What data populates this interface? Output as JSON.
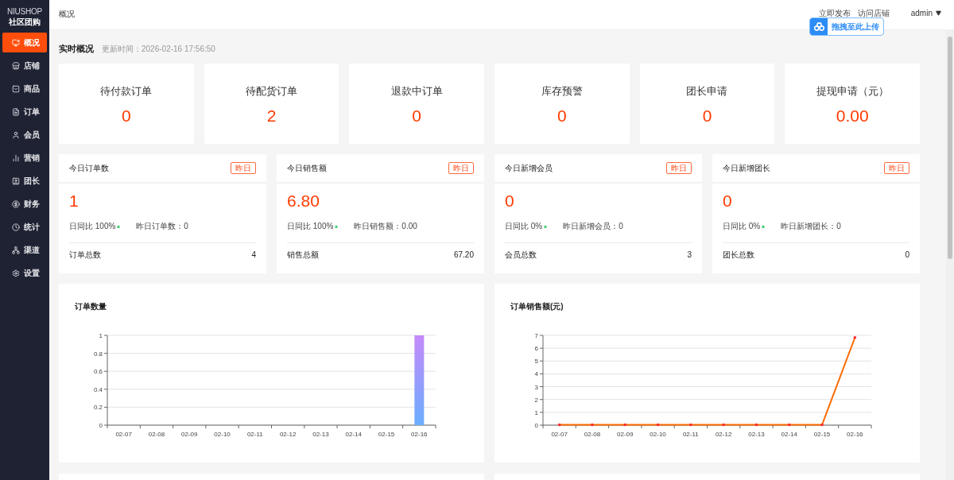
{
  "sidebar": {
    "logo": "NIUSHOP",
    "subtitle": "社区团购",
    "items": [
      {
        "label": "概况",
        "selected": true
      },
      {
        "label": "店铺",
        "selected": false
      },
      {
        "label": "商品",
        "selected": false
      },
      {
        "label": "订单",
        "selected": false
      },
      {
        "label": "会员",
        "selected": false
      },
      {
        "label": "营销",
        "selected": false
      },
      {
        "label": "团长",
        "selected": false
      },
      {
        "label": "财务",
        "selected": false
      },
      {
        "label": "统计",
        "selected": false
      },
      {
        "label": "渠道",
        "selected": false
      },
      {
        "label": "设置",
        "selected": false
      }
    ]
  },
  "header": {
    "breadcrumb": "概况",
    "links": [
      "立即发布",
      "访问店铺"
    ],
    "user": "admin"
  },
  "upload_widget": {
    "label": "拖拽至此上传"
  },
  "section": {
    "title": "实时概况",
    "updated": "更新时间：2026-02-16 17:56:50"
  },
  "stats": [
    {
      "label": "待付款订单",
      "value": "0"
    },
    {
      "label": "待配货订单",
      "value": "2"
    },
    {
      "label": "退款中订单",
      "value": "0"
    },
    {
      "label": "库存预警",
      "value": "0"
    },
    {
      "label": "团长申请",
      "value": "0"
    },
    {
      "label": "提现申请（元）",
      "value": "0.00"
    }
  ],
  "today_cards": [
    {
      "title": "今日订单数",
      "badge": "昨日",
      "value": "1",
      "ratio": "日同比 100%",
      "yesterday": "昨日订单数：0",
      "total_label": "订单总数",
      "total": "4"
    },
    {
      "title": "今日销售额",
      "badge": "昨日",
      "value": "6.80",
      "ratio": "日同比 100%",
      "yesterday": "昨日销售额：0.00",
      "total_label": "销售总额",
      "total": "67.20"
    },
    {
      "title": "今日新增会员",
      "badge": "昨日",
      "value": "0",
      "ratio": "日同比 0%",
      "yesterday": "昨日新增会员：0",
      "total_label": "会员总数",
      "total": "3"
    },
    {
      "title": "今日新增团长",
      "badge": "昨日",
      "value": "0",
      "ratio": "日同比 0%",
      "yesterday": "昨日新增团长：0",
      "total_label": "团长总数",
      "total": "0"
    }
  ],
  "charts": [
    {
      "title": "订单数量",
      "chart_data": {
        "type": "bar",
        "categories": [
          "02-07",
          "02-08",
          "02-09",
          "02-10",
          "02-11",
          "02-12",
          "02-13",
          "02-14",
          "02-15",
          "02-16"
        ],
        "values": [
          0,
          0,
          0,
          0,
          0,
          0,
          0,
          0,
          0,
          1
        ],
        "ylim": [
          0,
          1
        ],
        "yticks": [
          0,
          0.2,
          0.4,
          0.6,
          0.8,
          1
        ],
        "grid": true
      }
    },
    {
      "title": "订单销售额(元)",
      "chart_data": {
        "type": "line",
        "categories": [
          "02-07",
          "02-08",
          "02-09",
          "02-10",
          "02-11",
          "02-12",
          "02-13",
          "02-14",
          "02-15",
          "02-16"
        ],
        "series": [
          {
            "color": "#ff6a00",
            "values": [
              0,
              0,
              0,
              0,
              0,
              0,
              0,
              0,
              0,
              6.8
            ]
          }
        ],
        "ylim": [
          0,
          7
        ],
        "yticks": [
          0,
          1,
          2,
          3,
          4,
          5,
          6,
          7
        ],
        "grid": true
      }
    }
  ]
}
